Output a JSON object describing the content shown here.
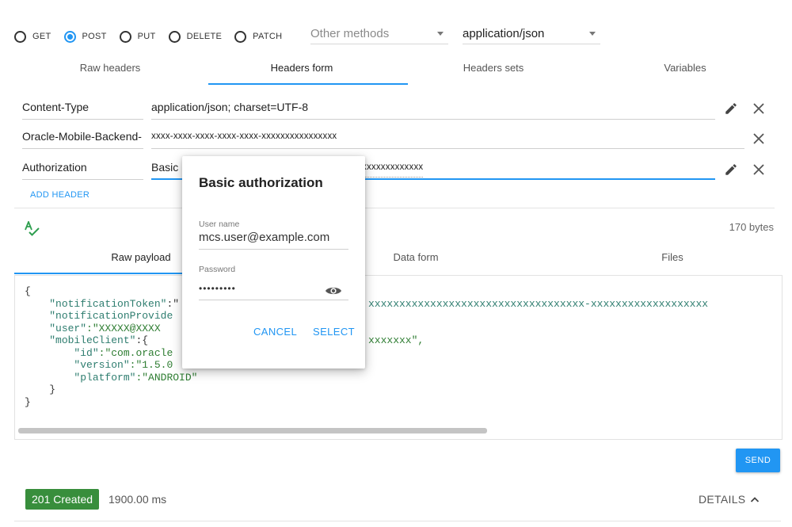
{
  "methods": {
    "options": [
      {
        "label": "GET",
        "selected": false
      },
      {
        "label": "POST",
        "selected": true
      },
      {
        "label": "PUT",
        "selected": false
      },
      {
        "label": "DELETE",
        "selected": false
      },
      {
        "label": "PATCH",
        "selected": false
      }
    ],
    "other_placeholder": "Other methods",
    "content_type": "application/json"
  },
  "header_tabs": [
    "Raw headers",
    "Headers form",
    "Headers sets",
    "Variables"
  ],
  "active_header_tab": "Headers form",
  "headers": [
    {
      "name": "Content-Type",
      "value": "application/json; charset=UTF-8"
    },
    {
      "name": "Oracle-Mobile-Backend-",
      "value": "xxxx-xxxx-xxxx-xxxx-xxxx-xxxxxxxxxxxxxxxx"
    },
    {
      "name": "Authorization",
      "value_start": "Basic",
      "value_end": "xxxxxxxxxxxxx"
    }
  ],
  "add_header_label": "ADD HEADER",
  "payload_size": "170 bytes",
  "payload_tabs": [
    "Raw payload",
    "Data form",
    "Files"
  ],
  "active_payload_tab": "Raw payload",
  "payload_lines": {
    "l1": "{",
    "l2_key": "\"notificationToken\"",
    "l2_rest": ":\"",
    "l2_tail": "xxxxxxxxxxxxxxxxxxxxxxxxxxxxxxxxxxx-xxxxxxxxxxxxxxxxxxx",
    "l3_key": "\"notificationProvide",
    "l4_key": "\"user\"",
    "l4_rest": ":\"XXXXX@XXXX",
    "l4_tail": "xxxxxxx\",",
    "l5_key": "\"mobileClient\"",
    "l5_rest": ":{",
    "l6_key": "\"id\"",
    "l6_rest": ":\"com.oracle",
    "l7_key": "\"version\"",
    "l7_rest": ":\"1.5.0",
    "l8_key": "\"platform\"",
    "l8_rest": ":\"ANDROID\"",
    "l9": "}",
    "l10": "}"
  },
  "send_label": "SEND",
  "response": {
    "status": "201 Created",
    "time": "1900.00 ms",
    "details_label": "DETAILS"
  },
  "dialog": {
    "title": "Basic authorization",
    "username_label": "User name",
    "username": "mcs.user@example.com",
    "password_label": "Password",
    "password_masked": "•••••••••",
    "cancel_label": "CANCEL",
    "select_label": "SELECT"
  },
  "colors": {
    "accent": "#2196f3",
    "success": "#388e3c",
    "json_key": "#2e7d6f",
    "json_string": "#2e7d32"
  },
  "icons": [
    "pencil-icon",
    "close-icon",
    "spellcheck-icon",
    "eye-icon",
    "chevron-up-icon",
    "dropdown-caret-icon"
  ]
}
